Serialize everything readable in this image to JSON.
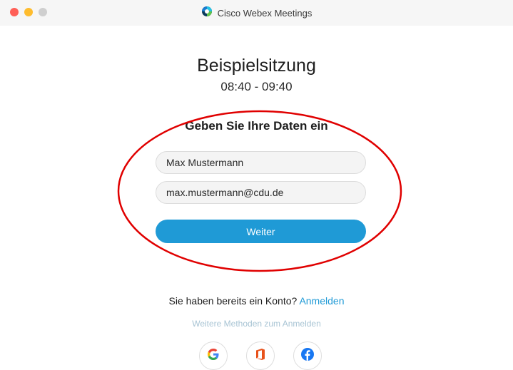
{
  "window": {
    "title": "Cisco Webex Meetings"
  },
  "meeting": {
    "title": "Beispielsitzung",
    "time": "08:40 - 09:40"
  },
  "form": {
    "heading": "Geben Sie Ihre Daten ein",
    "name_value": "Max Mustermann",
    "email_value": "max.mustermann@cdu.de",
    "continue_label": "Weiter"
  },
  "account": {
    "prompt": "Sie haben bereits ein Konto?",
    "signin_label": "Anmelden",
    "more_methods": "Weitere Methoden zum Anmelden"
  },
  "providers": [
    {
      "icon": "google-icon"
    },
    {
      "icon": "office-icon"
    },
    {
      "icon": "facebook-icon"
    }
  ],
  "colors": {
    "accent": "#1f9ad6",
    "annotation": "#e00000",
    "close": "#ff5f57",
    "minimize": "#febc2e",
    "maximize": "#cfcfcf"
  }
}
